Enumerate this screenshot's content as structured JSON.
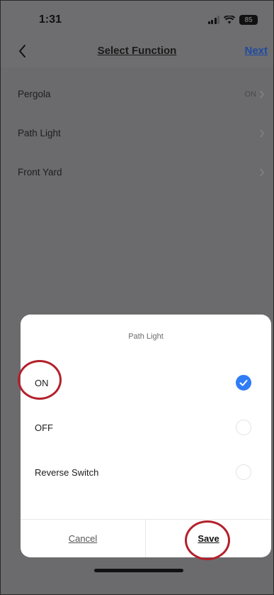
{
  "status_bar": {
    "time": "1:31",
    "battery": "85"
  },
  "nav": {
    "title": "Select Function",
    "next_label": "Next"
  },
  "functions": [
    {
      "label": "Pergola",
      "value": "ON"
    },
    {
      "label": "Path Light",
      "value": ""
    },
    {
      "label": "Front Yard",
      "value": ""
    }
  ],
  "sheet": {
    "title": "Path Light",
    "options": [
      {
        "label": "ON",
        "selected": true
      },
      {
        "label": "OFF",
        "selected": false
      },
      {
        "label": "Reverse Switch",
        "selected": false
      }
    ],
    "cancel_label": "Cancel",
    "save_label": "Save"
  },
  "colors": {
    "accent": "#2f7cf6",
    "highlight": "#b3202b",
    "link": "#1d4aa0"
  }
}
